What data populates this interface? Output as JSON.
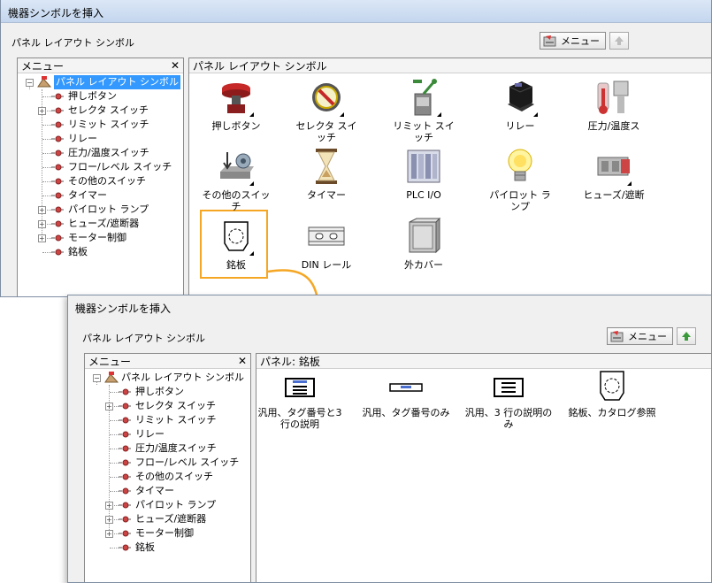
{
  "dialog1": {
    "title": "機器シンボルを挿入",
    "subtitle": "パネル レイアウト シンボル",
    "menu_label": "メニュー",
    "tree_header": "メニュー",
    "tree_root": "パネル レイアウト シンボル",
    "tree_items": [
      "押しボタン",
      "セレクタ スイッチ",
      "リミット スイッチ",
      "リレー",
      "圧力/温度スイッチ",
      "フロー/レベル スイッチ",
      "その他のスイッチ",
      "タイマー",
      "パイロット ランプ",
      "ヒューズ/遮断器",
      "モーター制御",
      "銘板"
    ],
    "content_header": "パネル レイアウト シンボル",
    "icons": [
      "押しボタン",
      "セレクタ スイッチ",
      "リミット スイッチ",
      "リレー",
      "圧力/温度ス",
      "その他のスイッチ",
      "タイマー",
      "PLC I/O",
      "パイロット ランプ",
      "ヒューズ/遮断",
      "銘板",
      "DIN レール",
      "外カバー"
    ]
  },
  "dialog2": {
    "title": "機器シンボルを挿入",
    "subtitle": "パネル レイアウト シンボル",
    "menu_label": "メニュー",
    "tree_header": "メニュー",
    "tree_root": "パネル レイアウト シンボル",
    "tree_items": [
      "押しボタン",
      "セレクタ スイッチ",
      "リミット スイッチ",
      "リレー",
      "圧力/温度スイッチ",
      "フロー/レベル スイッチ",
      "その他のスイッチ",
      "タイマー",
      "パイロット ランプ",
      "ヒューズ/遮断器",
      "モーター制御",
      "銘板"
    ],
    "content_header": "パネル: 銘板",
    "icons": [
      "汎用、タグ番号と3 行の説明",
      "汎用、タグ番号のみ",
      "汎用、3 行の説明のみ",
      "銘板、カタログ参照"
    ]
  },
  "colors": {
    "accent": "#f5a623",
    "selection": "#3399ff"
  },
  "icon_names": [
    "push-button-icon",
    "selector-switch-icon",
    "limit-switch-icon",
    "relay-icon",
    "pressure-temp-switch-icon",
    "other-switch-icon",
    "timer-icon",
    "plc-io-icon",
    "pilot-lamp-icon",
    "fuse-breaker-icon",
    "nameplate-icon",
    "din-rail-icon",
    "enclosure-icon"
  ]
}
